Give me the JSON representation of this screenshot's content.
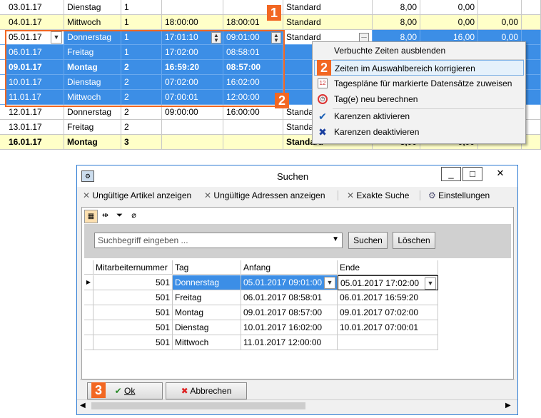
{
  "grid_rows": [
    {
      "date": "03.01.17",
      "day": "Dienstag",
      "week": "1",
      "start": "",
      "end": "",
      "plan": "Standard",
      "v1": "8,00",
      "v2": "0,00",
      "v3": "",
      "style": "white"
    },
    {
      "date": "04.01.17",
      "day": "Mittwoch",
      "week": "1",
      "start": "18:00:00",
      "end": "18:00:01",
      "plan": "Standard",
      "v1": "8,00",
      "v2": "0,00",
      "v3": "0,00",
      "style": "yellow"
    },
    {
      "date": "05.01.17",
      "day": "Donnerstag",
      "week": "1",
      "start": "17:01:10",
      "end": "09:01:00",
      "plan": "Standard",
      "v1": "8,00",
      "v2": "16,00",
      "v3": "0,00",
      "style": "sel"
    },
    {
      "date": "06.01.17",
      "day": "Freitag",
      "week": "1",
      "start": "17:02:00",
      "end": "08:58:01",
      "plan": "",
      "v1": "",
      "v2": "",
      "v3": "",
      "style": "sel"
    },
    {
      "date": "09.01.17",
      "day": "Montag",
      "week": "2",
      "start": "16:59:20",
      "end": "08:57:00",
      "plan": "",
      "v1": "",
      "v2": "",
      "v3": "",
      "style": "sel bold"
    },
    {
      "date": "10.01.17",
      "day": "Dienstag",
      "week": "2",
      "start": "07:02:00",
      "end": "16:02:00",
      "plan": "",
      "v1": "",
      "v2": "",
      "v3": "",
      "style": "sel"
    },
    {
      "date": "11.01.17",
      "day": "Mittwoch",
      "week": "2",
      "start": "07:00:01",
      "end": "12:00:00",
      "plan": "",
      "v1": "",
      "v2": "",
      "v3": "",
      "style": "sel"
    },
    {
      "date": "12.01.17",
      "day": "Donnerstag",
      "week": "2",
      "start": "09:00:00",
      "end": "16:00:00",
      "plan": "Standard",
      "v1": "",
      "v2": "",
      "v3": "",
      "style": "white"
    },
    {
      "date": "13.01.17",
      "day": "Freitag",
      "week": "2",
      "start": "",
      "end": "",
      "plan": "Standard",
      "v1": "",
      "v2": "",
      "v3": "",
      "style": "white"
    },
    {
      "date": "16.01.17",
      "day": "Montag",
      "week": "3",
      "start": "",
      "end": "",
      "plan": "Standard",
      "v1": "8,00",
      "v2": "0,00",
      "v3": "",
      "style": "yellow bold"
    }
  ],
  "context_menu": {
    "items": [
      {
        "label": "Verbuchte Zeiten ausblenden",
        "icon": ""
      },
      {
        "label": "Zeiten im Auswahlbereich korrigieren",
        "icon": ""
      },
      {
        "label": "Tagespläne für markierte Datensätze zuweisen",
        "icon": "calendar-icon"
      },
      {
        "label": "Tag(e) neu berechnen",
        "icon": "clock-icon"
      },
      {
        "label": "Karenzen aktivieren",
        "icon": "checkmark-icon"
      },
      {
        "label": "Karenzen deaktivieren",
        "icon": "cross-icon"
      }
    ]
  },
  "badges": {
    "one": "1",
    "two": "2",
    "three": "3"
  },
  "dialog": {
    "title": "Suchen",
    "toolbar": {
      "invalid_articles": "Ungültige Artikel anzeigen",
      "invalid_addresses": "Ungültige Adressen anzeigen",
      "exact_search": "Exakte Suche",
      "settings": "Einstellungen"
    },
    "search_placeholder": "Suchbegriff eingeben ...",
    "search_button": "Suchen",
    "clear_button": "Löschen",
    "columns": [
      "Mitarbeiternummer",
      "Tag",
      "Anfang",
      "Ende"
    ],
    "rows": [
      {
        "nr": "501",
        "tag": "Donnerstag",
        "anfang": "05.01.2017 09:01:00",
        "ende": "05.01.2017 17:02:00"
      },
      {
        "nr": "501",
        "tag": "Freitag",
        "anfang": "06.01.2017 08:58:01",
        "ende": "06.01.2017 16:59:20"
      },
      {
        "nr": "501",
        "tag": "Montag",
        "anfang": "09.01.2017 08:57:00",
        "ende": "09.01.2017 07:02:00"
      },
      {
        "nr": "501",
        "tag": "Dienstag",
        "anfang": "10.01.2017 16:02:00",
        "ende": "10.01.2017 07:00:01"
      },
      {
        "nr": "501",
        "tag": "Mittwoch",
        "anfang": "11.01.2017 12:00:00",
        "ende": ""
      }
    ],
    "ok_button": "Ok",
    "cancel_button": "Abbrechen"
  },
  "colors": {
    "selection": "#3c8ee6",
    "highlight_badge": "#f26722",
    "weekday_bg": "#ffffc8"
  }
}
